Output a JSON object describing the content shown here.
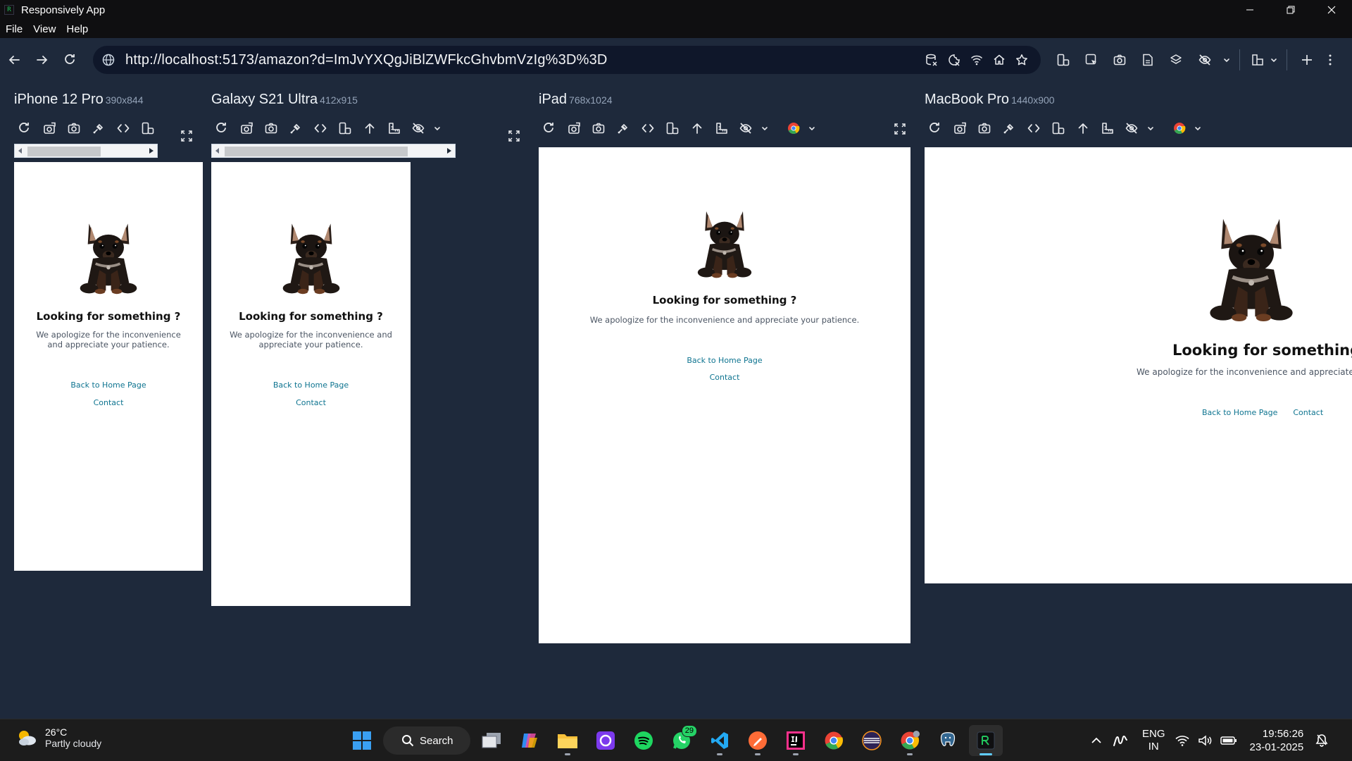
{
  "app": {
    "title": "Responsively App",
    "logo_text": "R"
  },
  "menu": [
    "File",
    "View",
    "Help"
  ],
  "address": {
    "url": "http://localhost:5173/amazon?d=ImJvYXQgJiBlZWFkcGhvbmVzIg%3D%3D"
  },
  "devices": [
    {
      "name": "iPhone 12 Pro",
      "resolution": "390x844"
    },
    {
      "name": "Galaxy S21 Ultra",
      "resolution": "412x915"
    },
    {
      "name": "iPad",
      "resolution": "768x1024"
    },
    {
      "name": "MacBook Pro",
      "resolution": "1440x900"
    }
  ],
  "page": {
    "heading": "Looking for something ?",
    "message": "We apologize for the inconvenience and appreciate your patience.",
    "home_link": "Back to Home Page",
    "contact_link": "Contact"
  },
  "taskbar": {
    "temperature": "26°C",
    "weather": "Partly cloudy",
    "search_label": "Search",
    "whatsapp_badge": "29",
    "lang_top": "ENG",
    "lang_bottom": "IN",
    "time": "19:56:26",
    "date": "23-01-2025"
  },
  "colors": {
    "app_background": "#1e293b",
    "titlebar": "#0f0f11",
    "link": "#0e7490",
    "taskbar": "#1c1c1c"
  },
  "icons": {
    "device_toolbar": [
      "refresh-icon",
      "screenshot-full-icon",
      "camera-icon",
      "inspect-icon",
      "code-icon",
      "rotate-icon",
      "scroll-top-icon",
      "ruler-icon",
      "hide-icon",
      "chrome-icon"
    ]
  }
}
